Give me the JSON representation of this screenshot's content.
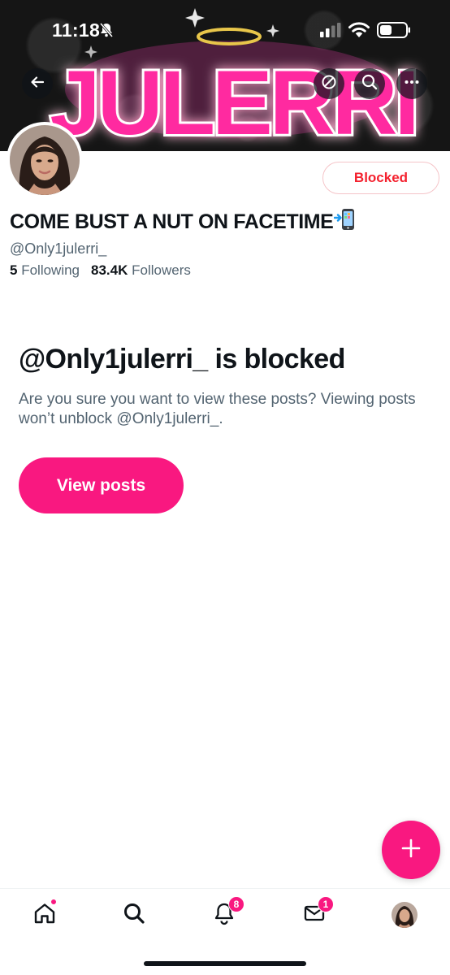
{
  "status_bar": {
    "time": "11:18",
    "icons": [
      "bell-slash-icon",
      "signal-icon",
      "wifi-icon",
      "battery-icon"
    ]
  },
  "banner": {
    "logo_text": "JULERRI",
    "colors": {
      "background": "#151515",
      "logo_fill": "#ff2aa0",
      "logo_glow": "#ff4fc3",
      "halo": "#e8c64a"
    }
  },
  "top_nav": {
    "icons": [
      "back-arrow-icon",
      "block-icon",
      "search-icon",
      "more-icon"
    ]
  },
  "profile": {
    "display_name": "COME BUST A NUT ON FACETIME",
    "name_emoji": "phone-with-arrow-icon",
    "handle": "@Only1julerri_",
    "following_count": "5",
    "following_label": "Following",
    "followers_count": "83.4K",
    "followers_label": "Followers",
    "blocked_button_label": "Blocked"
  },
  "blocked_notice": {
    "title": "@Only1julerri_ is blocked",
    "description": "Are you sure you want to view these posts? Viewing posts won’t unblock @Only1julerri_.",
    "button_label": "View posts"
  },
  "fab": {
    "icon": "plus-icon"
  },
  "tab_bar": {
    "items": [
      {
        "name": "home",
        "icon": "home-icon",
        "has_dot": true
      },
      {
        "name": "search",
        "icon": "search-icon"
      },
      {
        "name": "notifications",
        "icon": "bell-icon",
        "badge": "8"
      },
      {
        "name": "messages",
        "icon": "envelope-icon",
        "badge": "1"
      },
      {
        "name": "profile",
        "icon": "avatar"
      }
    ]
  },
  "colors": {
    "accent": "#f91880",
    "blocked_text": "#f4212e",
    "primary_text": "#0f1419",
    "secondary_text": "#536471"
  }
}
